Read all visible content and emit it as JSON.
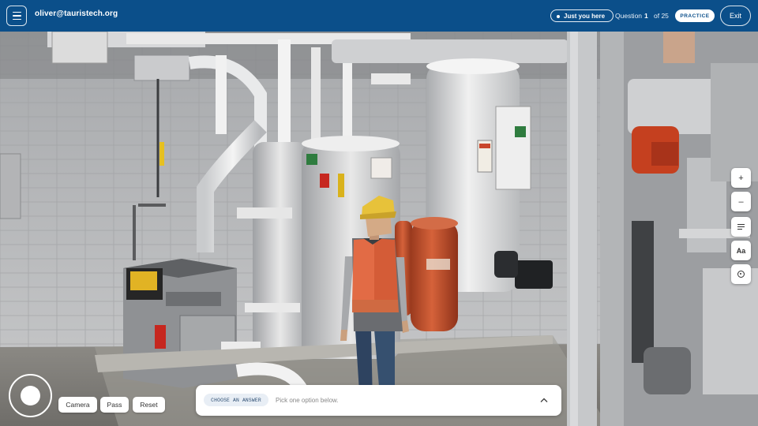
{
  "header": {
    "user_email": "oliver@tauristech.org",
    "audience_label": "Just you here",
    "question_label": "Question",
    "question_number": "1",
    "question_total": "of 25",
    "mode_label": "PRACTICE",
    "exit_label": "Exit"
  },
  "toolbar": {
    "zoom_in_label": "+",
    "zoom_out_label": "–",
    "text_size_label": "Aa"
  },
  "controls": {
    "camera_label": "Camera",
    "pass_label": "Pass",
    "reset_label": "Reset"
  },
  "answer_panel": {
    "choose_label": "CHOOSE AN ANSWER",
    "hint": "Pick one option below."
  },
  "icons": {
    "menu": "hamburger-icon",
    "audience": "dot-icon",
    "outline": "lines-icon",
    "recenter": "target-icon",
    "expand": "chevron-up-icon"
  },
  "colors": {
    "header_bg": "#0b4f8a",
    "vest": "#e26b45",
    "hard_hat": "#e7c23a",
    "expansion_tank": "#c9552f"
  }
}
